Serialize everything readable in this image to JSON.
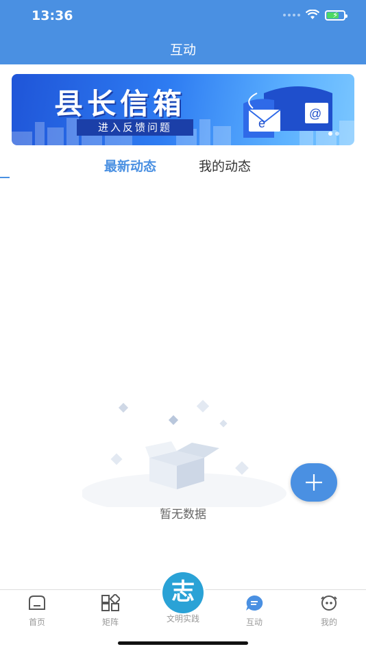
{
  "status_bar": {
    "time": "13:36"
  },
  "navbar": {
    "title": "互动"
  },
  "banner": {
    "title": "县长信箱",
    "subtitle": "进入反馈问题"
  },
  "tabs": [
    {
      "label": "最新动态",
      "active": true
    },
    {
      "label": "我的动态",
      "active": false
    }
  ],
  "empty_state": {
    "text": "暂无数据"
  },
  "fab": {
    "icon": "plus-icon"
  },
  "tab_bar": {
    "items": [
      {
        "label": "首页",
        "icon": "home-icon",
        "active": false
      },
      {
        "label": "矩阵",
        "icon": "grid-icon",
        "active": false
      },
      {
        "label": "文明实践",
        "icon": "volunteer-badge-icon",
        "active": false,
        "badge_text": "志"
      },
      {
        "label": "互动",
        "icon": "chat-icon",
        "active": true
      },
      {
        "label": "我的",
        "icon": "face-icon",
        "active": false
      }
    ]
  },
  "colors": {
    "accent": "#4a90e2",
    "badge": "#2aa2d6"
  }
}
